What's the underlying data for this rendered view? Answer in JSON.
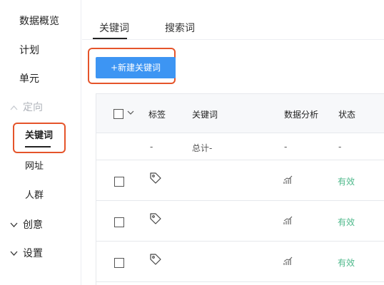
{
  "sidebar": {
    "items": [
      {
        "label": "数据概览"
      },
      {
        "label": "计划"
      },
      {
        "label": "单元"
      },
      {
        "label": "定向"
      },
      {
        "label": "关键词"
      },
      {
        "label": "网址"
      },
      {
        "label": "人群"
      },
      {
        "label": "创意"
      },
      {
        "label": "设置"
      }
    ]
  },
  "tabs": [
    {
      "label": "关键词",
      "active": true
    },
    {
      "label": "搜索词",
      "active": false
    }
  ],
  "toolbar": {
    "new_keyword_label": "+新建关键词"
  },
  "table": {
    "columns": [
      "标签",
      "关键词",
      "数据分析",
      "状态"
    ],
    "total_row": {
      "tag": "-",
      "keyword": "总计-",
      "analysis": "-",
      "status": "-"
    },
    "rows": [
      {
        "status": "有效"
      },
      {
        "status": "有效"
      },
      {
        "status": "有效"
      }
    ]
  },
  "colors": {
    "primary_button": "#3d95f3",
    "highlight": "#e5542a",
    "status_valid": "#4fb98c"
  },
  "icons": {
    "tag": "tag-icon",
    "analysis": "trend-chart-icon",
    "expand": "chevron-down-icon",
    "collapse": "chevron-up-icon"
  }
}
